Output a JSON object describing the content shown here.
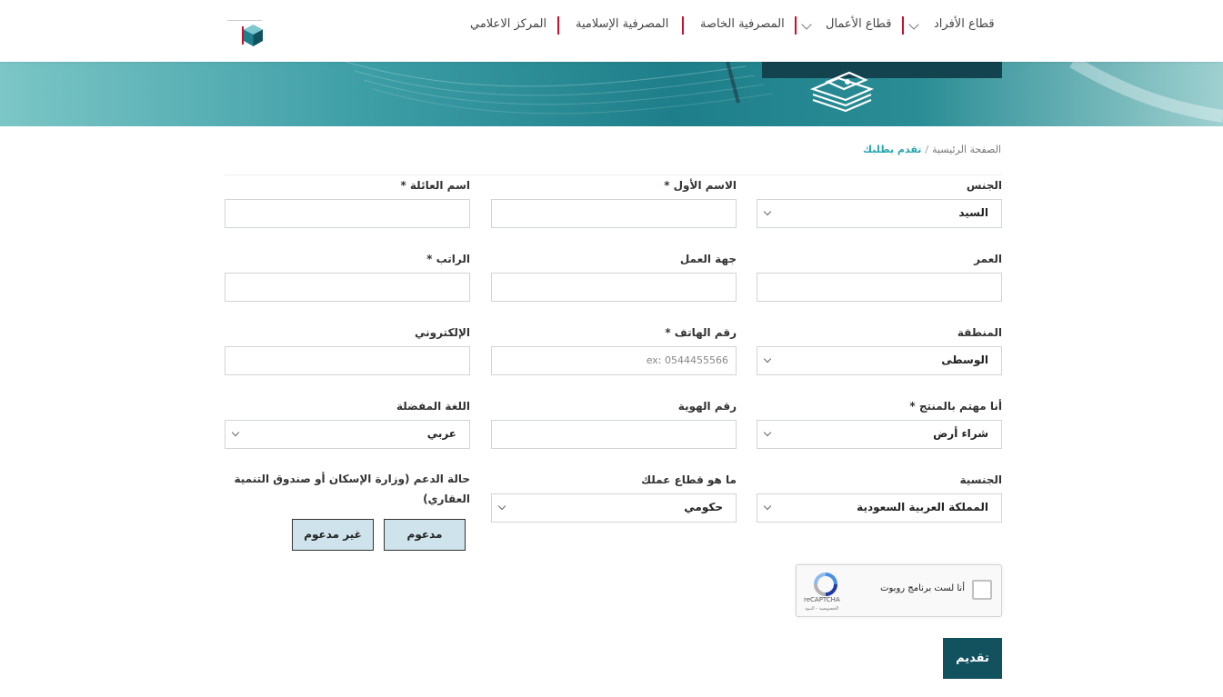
{
  "nav": {
    "items": [
      "قطاع الأفراد",
      "قطاع الأعمال",
      "المصرفية الخاصة",
      "المصرفية الإسلامية",
      "المركز الاعلامي"
    ]
  },
  "breadcrumb": {
    "home": "الصفحة الرئيسية",
    "separator": "/",
    "current": "تقدم بطلبك"
  },
  "form": {
    "gender": {
      "label": "الجنس",
      "value": "السيد"
    },
    "first_name": {
      "label": "الاسم الأول *",
      "value": ""
    },
    "family_name": {
      "label": "اسم العائلة *",
      "value": ""
    },
    "age": {
      "label": "العمر",
      "value": ""
    },
    "employer": {
      "label": "جهة العمل",
      "value": ""
    },
    "salary": {
      "label": "الراتب *",
      "value": ""
    },
    "region": {
      "label": "المنطقة",
      "value": "الوسطى"
    },
    "phone": {
      "label": "رقم الهاتف *",
      "placeholder": "ex: 0544455566"
    },
    "email": {
      "label": "الإلكتروني",
      "value": ""
    },
    "product": {
      "label": "أنا مهتم بالمنتج *",
      "value": "شراء أرض"
    },
    "id_number": {
      "label": "رقم الهوية",
      "value": ""
    },
    "language": {
      "label": "اللغة المفضلة",
      "value": "عربي"
    },
    "nationality": {
      "label": "الجنسية",
      "value": "المملكة العربية السعودية"
    },
    "sector": {
      "label": "ما هو قطاع عملك",
      "value": "حكومي"
    },
    "support": {
      "label": "حالة الدعم (وزارة الإسكان أو صندوق التنمية العقاري)",
      "options": [
        "مدعوم",
        "غير مدعوم"
      ]
    }
  },
  "captcha": {
    "label": "أنا لست برنامج روبوت",
    "brand": "reCAPTCHA",
    "terms": "الخصوصية - البنود"
  },
  "submit_label": "تقديم",
  "colors": {
    "accent": "#2aa6b0",
    "submit": "#12525f",
    "nav_separator": "#c8102e",
    "toggle_bg": "#cfe3ec"
  }
}
